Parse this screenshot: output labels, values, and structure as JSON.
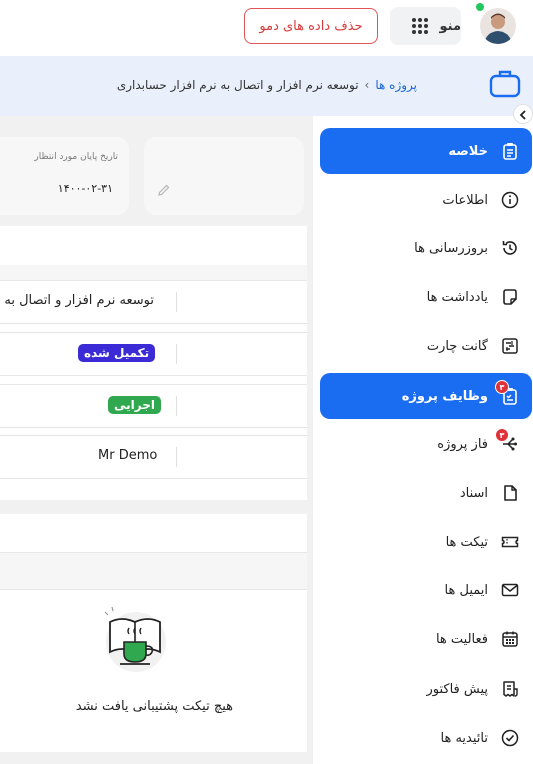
{
  "header": {
    "user_menu_label": "منو",
    "delete_demo_label": "حذف داده های دمو"
  },
  "breadcrumb": {
    "root": "پروژه ها",
    "separator": "›",
    "current": "توسعه نرم افزار و اتصال به نرم افزار حسابداری"
  },
  "sidebar": {
    "items": [
      {
        "label": "خلاصه",
        "icon": "clipboard-icon",
        "active": true
      },
      {
        "label": "اطلاعات",
        "icon": "info-icon"
      },
      {
        "label": "بروزرسانی ها",
        "icon": "history-icon"
      },
      {
        "label": "یادداشت ها",
        "icon": "note-icon"
      },
      {
        "label": "گانت چارت",
        "icon": "gantt-icon"
      },
      {
        "label": "وظایف پروژه",
        "icon": "tasks-icon",
        "active": true,
        "badge": "۳"
      },
      {
        "label": "فاز پروژه",
        "icon": "phase-icon",
        "badge": "۳"
      },
      {
        "label": "اسناد",
        "icon": "file-icon"
      },
      {
        "label": "تیکت ها",
        "icon": "ticket-icon"
      },
      {
        "label": "ایمیل ها",
        "icon": "mail-icon"
      },
      {
        "label": "فعالیت ها",
        "icon": "calendar-icon"
      },
      {
        "label": "پیش فاکتور",
        "icon": "invoice-icon"
      },
      {
        "label": "تائیدیه ها",
        "icon": "check-icon"
      }
    ]
  },
  "summary": {
    "expected_end_label": "تاریخ پایان مورد انتظار",
    "expected_end_date": "۱۴۰۰-۰۲-۳۱"
  },
  "details": {
    "project_name": "توسعه نرم افزار و اتصال به",
    "status_tag": "تکمیل شده",
    "status_color": "#3b2bd6",
    "phase_tag": "اجرایی",
    "phase_color": "#2fa84f",
    "owner": "Mr Demo"
  },
  "tickets": {
    "empty_message": "هیچ تیکت پشتیبانی یافت نشد"
  },
  "colors": {
    "accent": "#1a6df0",
    "danger": "#e0313a"
  }
}
